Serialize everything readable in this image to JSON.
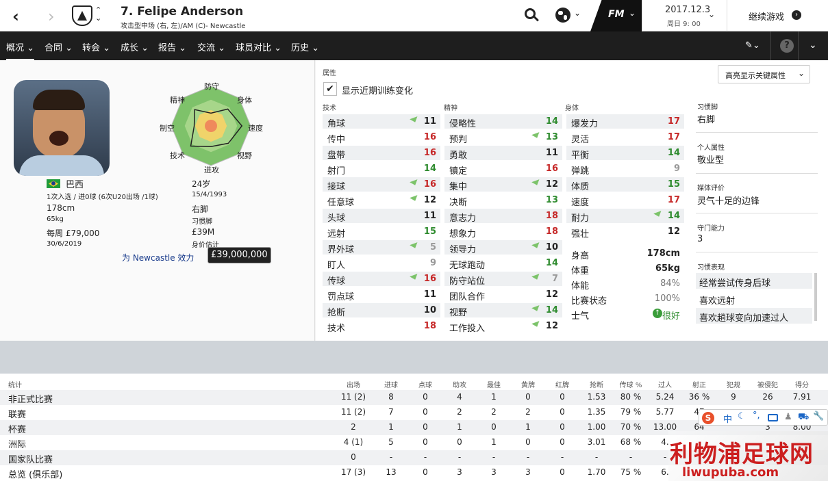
{
  "header": {
    "player_name": "7. Felipe Anderson",
    "player_sub": "攻击型中场 (右, 左)/AM (C)- Newcastle",
    "fm_label": "FM",
    "date": "2017.12.3",
    "day_time": "周日 9: 00",
    "continue_label": "继续游戏"
  },
  "nav": {
    "items": [
      "概况",
      "合同",
      "转会",
      "成长",
      "报告",
      "交流",
      "球员对比",
      "历史"
    ]
  },
  "profile": {
    "nationality": "巴西",
    "caps": "1次入选 / 进0球 (6次U20出场 /1球)",
    "height": "178cm",
    "weight": "65kg",
    "wage": "每周 £79,000",
    "contract_end": "30/6/2019",
    "age": "24岁",
    "dob": "15/4/1993",
    "foot": "右脚",
    "foot_label": "习惯脚",
    "value": "£39M",
    "value_label": "身价估计",
    "club_link": "为 Newcastle 效力",
    "value_tooltip": "£39,000,000"
  },
  "radar": {
    "labels": [
      "防守",
      "身体",
      "速度",
      "视野",
      "进攻",
      "技术",
      "制空",
      "精神"
    ],
    "levels": [
      0.32,
      0.6,
      0.78,
      0.62,
      0.52,
      0.72,
      0.42,
      0.58
    ]
  },
  "attributes": {
    "section_title": "属性",
    "highlight_label": "高亮显示关键属性",
    "show_training_label": "显示近期训练变化",
    "col_technical": "技术",
    "col_mental": "精神",
    "col_physical": "身体",
    "technical": [
      {
        "name": "角球",
        "value": "11",
        "arrow": true,
        "color": "#222"
      },
      {
        "name": "传中",
        "value": "16",
        "arrow": false,
        "color": "#c62828"
      },
      {
        "name": "盘带",
        "value": "16",
        "arrow": false,
        "color": "#c62828"
      },
      {
        "name": "射门",
        "value": "14",
        "arrow": false,
        "color": "#2e8b2e"
      },
      {
        "name": "接球",
        "value": "16",
        "arrow": true,
        "color": "#c62828"
      },
      {
        "name": "任意球",
        "value": "12",
        "arrow": true,
        "color": "#222"
      },
      {
        "name": "头球",
        "value": "11",
        "arrow": false,
        "color": "#222"
      },
      {
        "name": "远射",
        "value": "15",
        "arrow": false,
        "color": "#2e8b2e"
      },
      {
        "name": "界外球",
        "value": "5",
        "arrow": true,
        "color": "#999"
      },
      {
        "name": "盯人",
        "value": "9",
        "arrow": false,
        "color": "#999"
      },
      {
        "name": "传球",
        "value": "16",
        "arrow": true,
        "color": "#c62828"
      },
      {
        "name": "罚点球",
        "value": "11",
        "arrow": false,
        "color": "#222"
      },
      {
        "name": "抢断",
        "value": "10",
        "arrow": false,
        "color": "#222"
      },
      {
        "name": "技术",
        "value": "18",
        "arrow": false,
        "color": "#c62828"
      }
    ],
    "mental": [
      {
        "name": "侵略性",
        "value": "14",
        "arrow": false,
        "color": "#2e8b2e"
      },
      {
        "name": "预判",
        "value": "13",
        "arrow": true,
        "color": "#2e8b2e"
      },
      {
        "name": "勇敢",
        "value": "11",
        "arrow": false,
        "color": "#222"
      },
      {
        "name": "镇定",
        "value": "16",
        "arrow": false,
        "color": "#c62828"
      },
      {
        "name": "集中",
        "value": "12",
        "arrow": true,
        "color": "#222"
      },
      {
        "name": "决断",
        "value": "13",
        "arrow": false,
        "color": "#2e8b2e"
      },
      {
        "name": "意志力",
        "value": "18",
        "arrow": false,
        "color": "#c62828"
      },
      {
        "name": "想象力",
        "value": "18",
        "arrow": false,
        "color": "#c62828"
      },
      {
        "name": "领导力",
        "value": "10",
        "arrow": true,
        "color": "#222"
      },
      {
        "name": "无球跑动",
        "value": "14",
        "arrow": false,
        "color": "#2e8b2e"
      },
      {
        "name": "防守站位",
        "value": "7",
        "arrow": true,
        "color": "#999"
      },
      {
        "name": "团队合作",
        "value": "12",
        "arrow": false,
        "color": "#222"
      },
      {
        "name": "视野",
        "value": "14",
        "arrow": true,
        "color": "#2e8b2e"
      },
      {
        "name": "工作投入",
        "value": "12",
        "arrow": true,
        "color": "#222"
      }
    ],
    "physical": [
      {
        "name": "爆发力",
        "value": "17",
        "arrow": false,
        "color": "#c62828"
      },
      {
        "name": "灵活",
        "value": "17",
        "arrow": false,
        "color": "#c62828"
      },
      {
        "name": "平衡",
        "value": "14",
        "arrow": false,
        "color": "#2e8b2e"
      },
      {
        "name": "弹跳",
        "value": "9",
        "arrow": false,
        "color": "#999"
      },
      {
        "name": "体质",
        "value": "15",
        "arrow": false,
        "color": "#2e8b2e"
      },
      {
        "name": "速度",
        "value": "17",
        "arrow": false,
        "color": "#c62828"
      },
      {
        "name": "耐力",
        "value": "14",
        "arrow": true,
        "color": "#2e8b2e"
      },
      {
        "name": "强壮",
        "value": "12",
        "arrow": false,
        "color": "#222"
      }
    ],
    "physical_info": [
      {
        "name": "身高",
        "value": "178cm"
      },
      {
        "name": "体重",
        "value": "65kg"
      },
      {
        "name": "体能",
        "value": "84%"
      },
      {
        "name": "比赛状态",
        "value": "100%"
      },
      {
        "name": "士气",
        "value": "很好"
      }
    ]
  },
  "right": {
    "foot_label": "习惯脚",
    "foot_value": "右脚",
    "personality_label": "个人属性",
    "personality_value": "敬业型",
    "media_label": "媒体评价",
    "media_value": "灵气十足的边锋",
    "defend_label": "守门能力",
    "defend_value": "3",
    "habits_label": "习惯表现",
    "habits": [
      "经常尝试传身后球",
      "喜欢远射",
      "喜欢趟球变向加速过人"
    ]
  },
  "stats": {
    "headers": [
      "统计",
      "出场",
      "进球",
      "点球",
      "助攻",
      "最佳",
      "黄牌",
      "红牌",
      "抢断",
      "传球 %",
      "过人",
      "射正",
      "犯规",
      "被侵犯",
      "得分"
    ],
    "rows": [
      [
        "非正式比赛",
        "11 (2)",
        "8",
        "0",
        "4",
        "1",
        "0",
        "0",
        "1.53",
        "80 %",
        "5.24",
        "36 %",
        "9",
        "26",
        "7.91"
      ],
      [
        "联赛",
        "11 (2)",
        "7",
        "0",
        "2",
        "2",
        "2",
        "0",
        "1.35",
        "79 %",
        "5.77",
        "47",
        "",
        "",
        ""
      ],
      [
        "杯赛",
        "2",
        "1",
        "0",
        "1",
        "0",
        "1",
        "0",
        "1.00",
        "70 %",
        "13.00",
        "64",
        "",
        "3",
        "8.00"
      ],
      [
        "洲际",
        "4 (1)",
        "5",
        "0",
        "0",
        "1",
        "0",
        "0",
        "3.01",
        "68 %",
        "4.",
        "",
        "",
        "",
        ""
      ],
      [
        "国家队比赛",
        "0",
        "-",
        "-",
        "-",
        "-",
        "-",
        "-",
        "-",
        "-",
        "-",
        "",
        "",
        "",
        ""
      ],
      [
        "总览 (俱乐部)",
        "17 (3)",
        "13",
        "0",
        "3",
        "3",
        "3",
        "0",
        "1.70",
        "75 %",
        "6.",
        "",
        "",
        "",
        ""
      ]
    ]
  },
  "watermark": {
    "brand": "利物浦足球网",
    "url": "liwupuba.com",
    "ime_text": "中"
  }
}
